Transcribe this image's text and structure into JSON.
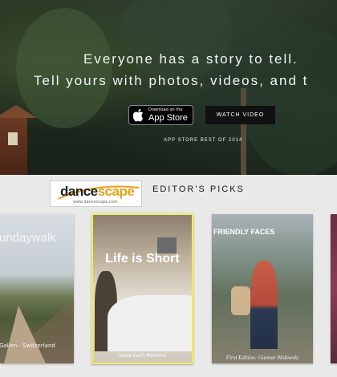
{
  "hero": {
    "title": "Everyone has a story to tell.",
    "subtitle": "Tell yours with photos, videos, and t",
    "appstore_small": "Download on the",
    "appstore_big": "App Store",
    "watch_label": "WATCH VIDEO",
    "best_label": "APP STORE BEST OF 2014"
  },
  "logo": {
    "word_main": "dance",
    "word_accent": "scape",
    "url": "www.dancescape.com"
  },
  "picks": {
    "title": "EDITOR'S PICKS",
    "cards": [
      {
        "title": "undaywalk",
        "caption": "Gallen · Switzerland"
      },
      {
        "title": "Life is Short",
        "caption": "Seize Each Moment"
      },
      {
        "title": "FRIENDLY FACES",
        "caption": "First Edition: Gunnar Widowski"
      },
      {
        "title": "",
        "caption": ""
      }
    ]
  },
  "colors": {
    "highlight_border": "#f5e86a",
    "logo_accent": "#e3a21a"
  }
}
